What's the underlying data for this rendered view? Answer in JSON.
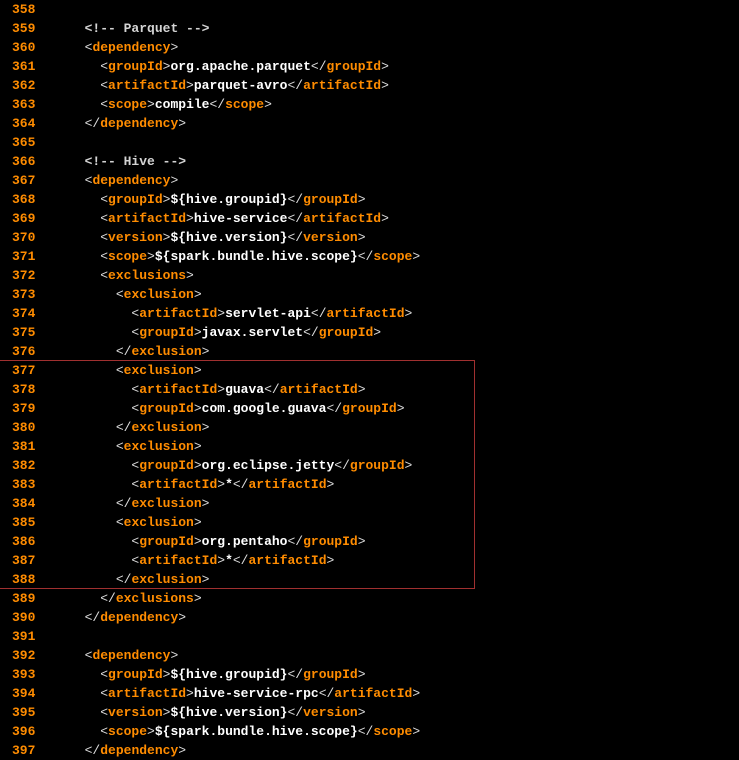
{
  "startLine": 358,
  "highlight": {
    "from": 377,
    "to": 388
  },
  "lines": [
    {
      "n": 358,
      "c": ""
    },
    {
      "n": 359,
      "c": "    <!-- Parquet -->"
    },
    {
      "n": 360,
      "c": "    <dependency>"
    },
    {
      "n": 361,
      "c": "      <groupId>org.apache.parquet</groupId>"
    },
    {
      "n": 362,
      "c": "      <artifactId>parquet-avro</artifactId>"
    },
    {
      "n": 363,
      "c": "      <scope>compile</scope>"
    },
    {
      "n": 364,
      "c": "    </dependency>"
    },
    {
      "n": 365,
      "c": ""
    },
    {
      "n": 366,
      "c": "    <!-- Hive -->"
    },
    {
      "n": 367,
      "c": "    <dependency>"
    },
    {
      "n": 368,
      "c": "      <groupId>${hive.groupid}</groupId>"
    },
    {
      "n": 369,
      "c": "      <artifactId>hive-service</artifactId>"
    },
    {
      "n": 370,
      "c": "      <version>${hive.version}</version>"
    },
    {
      "n": 371,
      "c": "      <scope>${spark.bundle.hive.scope}</scope>"
    },
    {
      "n": 372,
      "c": "      <exclusions>"
    },
    {
      "n": 373,
      "c": "        <exclusion>"
    },
    {
      "n": 374,
      "c": "          <artifactId>servlet-api</artifactId>"
    },
    {
      "n": 375,
      "c": "          <groupId>javax.servlet</groupId>"
    },
    {
      "n": 376,
      "c": "        </exclusion>"
    },
    {
      "n": 377,
      "c": "        <exclusion>"
    },
    {
      "n": 378,
      "c": "          <artifactId>guava</artifactId>"
    },
    {
      "n": 379,
      "c": "          <groupId>com.google.guava</groupId>"
    },
    {
      "n": 380,
      "c": "        </exclusion>"
    },
    {
      "n": 381,
      "c": "        <exclusion>"
    },
    {
      "n": 382,
      "c": "          <groupId>org.eclipse.jetty</groupId>"
    },
    {
      "n": 383,
      "c": "          <artifactId>*</artifactId>"
    },
    {
      "n": 384,
      "c": "        </exclusion>"
    },
    {
      "n": 385,
      "c": "        <exclusion>"
    },
    {
      "n": 386,
      "c": "          <groupId>org.pentaho</groupId>"
    },
    {
      "n": 387,
      "c": "          <artifactId>*</artifactId>"
    },
    {
      "n": 388,
      "c": "        </exclusion>"
    },
    {
      "n": 389,
      "c": "      </exclusions>"
    },
    {
      "n": 390,
      "c": "    </dependency>"
    },
    {
      "n": 391,
      "c": ""
    },
    {
      "n": 392,
      "c": "    <dependency>"
    },
    {
      "n": 393,
      "c": "      <groupId>${hive.groupid}</groupId>"
    },
    {
      "n": 394,
      "c": "      <artifactId>hive-service-rpc</artifactId>"
    },
    {
      "n": 395,
      "c": "      <version>${hive.version}</version>"
    },
    {
      "n": 396,
      "c": "      <scope>${spark.bundle.hive.scope}</scope>"
    },
    {
      "n": 397,
      "c": "    </dependency>"
    }
  ]
}
